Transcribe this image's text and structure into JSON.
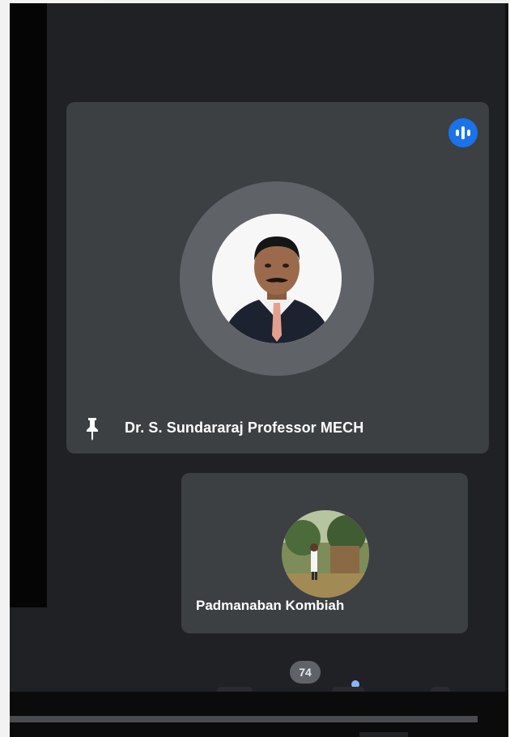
{
  "meeting": {
    "main_participant": {
      "name": "Dr. S. Sundararaj Professor MECH",
      "pinned": true,
      "speaking": true
    },
    "secondary_participant": {
      "name": "Padmanaban Kombiah"
    },
    "participant_count": "74"
  },
  "icons": {
    "speaking": "audio-level-icon",
    "pin": "pin-icon",
    "avatar": "avatar-photo"
  },
  "colors": {
    "background": "#202124",
    "tile": "#3c4043",
    "accent": "#1a73e8"
  }
}
